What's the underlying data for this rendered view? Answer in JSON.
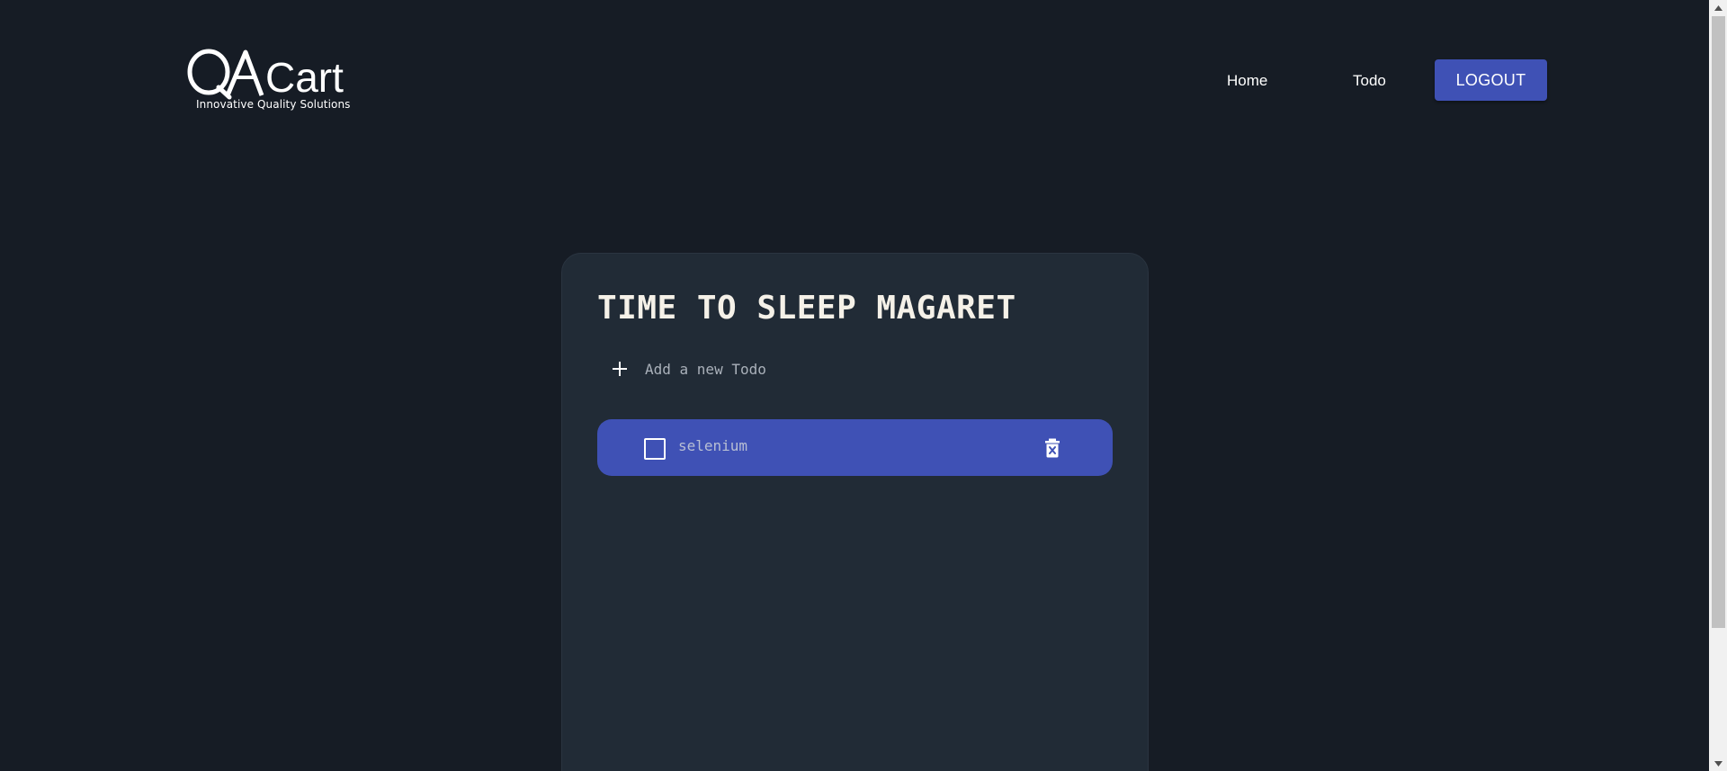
{
  "header": {
    "logo_text": "QA Cart",
    "logo_tagline": "Innovative Quality Solutions",
    "nav": {
      "home_label": "Home",
      "todo_label": "Todo",
      "logout_label": "LOGOUT"
    }
  },
  "todo_card": {
    "title": "TIME TO SLEEP MAGARET",
    "new_todo_placeholder": "Add a new Todo",
    "items": [
      {
        "text": "selenium",
        "completed": false
      }
    ]
  },
  "colors": {
    "background": "#161c25",
    "card": "#212b36",
    "accent": "#3f51b5"
  },
  "icons": {
    "add": "plus-icon",
    "delete": "trash-icon",
    "complete": "checkbox"
  }
}
